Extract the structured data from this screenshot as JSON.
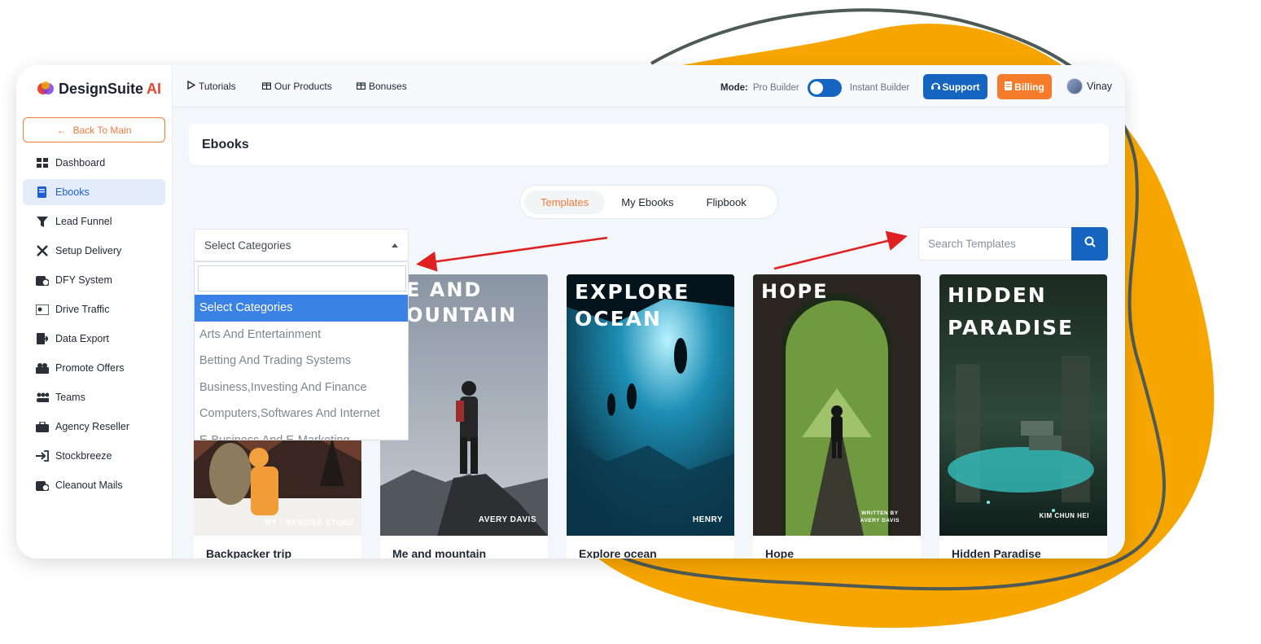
{
  "brand": {
    "name_main": "DesignSuite",
    "name_accent": "AI"
  },
  "sidebar": {
    "back_label": "Back To Main",
    "items": [
      {
        "label": "Dashboard",
        "icon": "grid-icon"
      },
      {
        "label": "Ebooks",
        "icon": "book-icon",
        "active": true
      },
      {
        "label": "Lead Funnel",
        "icon": "funnel-icon"
      },
      {
        "label": "Setup Delivery",
        "icon": "tools-icon"
      },
      {
        "label": "DFY System",
        "icon": "system-icon"
      },
      {
        "label": "Drive Traffic",
        "icon": "traffic-icon"
      },
      {
        "label": "Data Export",
        "icon": "export-icon"
      },
      {
        "label": "Promote Offers",
        "icon": "offers-icon"
      },
      {
        "label": "Teams",
        "icon": "teams-icon"
      },
      {
        "label": "Agency Reseller",
        "icon": "briefcase-icon"
      },
      {
        "label": "Stockbreeze",
        "icon": "sign-in-icon"
      },
      {
        "label": "Cleanout Mails",
        "icon": "mail-clean-icon"
      }
    ]
  },
  "topbar": {
    "tutorials": "Tutorials",
    "our_products": "Our Products",
    "bonuses": "Bonuses",
    "mode_label": "Mode:",
    "mode_left": "Pro Builder",
    "mode_right": "Instant Builder",
    "support": "Support",
    "billing": "Billing",
    "user": "Vinay"
  },
  "page": {
    "title": "Ebooks",
    "tabs": [
      "Templates",
      "My Ebooks",
      "Flipbook"
    ],
    "active_tab": "Templates",
    "category_select": "Select Categories",
    "search_placeholder": "Search Templates",
    "dropdown_options": [
      "Select Categories",
      "Arts And Entertainment",
      "Betting And Trading Systems",
      "Business,Investing And Finance",
      "Computers,Softwares And Internet",
      "E-Business And E-Marketing"
    ]
  },
  "cards": [
    {
      "title": "Backpacker trip",
      "cover_text": "",
      "author": "BY : SANDRA STONE"
    },
    {
      "title": "Me and mountain",
      "cover_text": "E AND\nOUNTAIN",
      "author": "AVERY DAVIS"
    },
    {
      "title": "Explore ocean",
      "cover_text": "EXPLORE\nOCEAN",
      "author": "HENRY"
    },
    {
      "title": "Hope",
      "cover_text": "HOPE",
      "author": "WRITTEN BY\nAVERY DAVIS"
    },
    {
      "title": "Hidden Paradise",
      "cover_text": "HIDDEN\nPARADISE",
      "author": "KIM CHUN HEI"
    }
  ],
  "colors": {
    "primary": "#1565c0",
    "accent": "#f57c2a",
    "blob": "#f7a600"
  }
}
